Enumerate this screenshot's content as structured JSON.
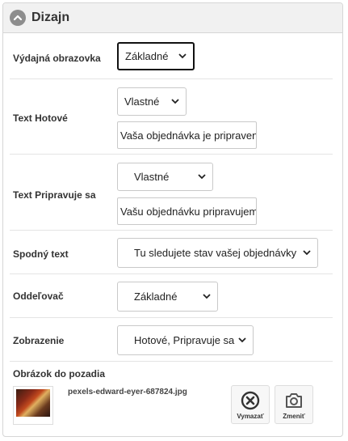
{
  "header": {
    "title": "Dizajn",
    "collapse_icon": "chevron-up-circle-icon"
  },
  "rows": {
    "vydajna": {
      "label": "Výdajná obrazovka",
      "select_value": "Základné"
    },
    "hotove": {
      "label": "Text Hotové",
      "select_value": "Vlastné",
      "input_value": "Vaša objednávka je pripravená"
    },
    "pripravuje": {
      "label": "Text Pripravuje sa",
      "select_value": "Vlastné",
      "input_value": "Vašu objednávku pripravujeme"
    },
    "spodny": {
      "label": "Spodný text",
      "select_value": "Tu sledujete stav vašej objednávky"
    },
    "oddelovac": {
      "label": "Oddeľovač",
      "select_value": "Základné"
    },
    "zobrazenie": {
      "label": "Zobrazenie",
      "select_value": "Hotové, Pripravuje sa"
    },
    "obrazok": {
      "label": "Obrázok do pozadia",
      "filename": "pexels-edward-eyer-687824.jpg",
      "delete_label": "Vymazať",
      "change_label": "Zmeniť"
    }
  },
  "colors": {
    "header_bg": "#f1f1f1",
    "border": "#d6d6d6",
    "icon_gray": "#8d8d8d"
  }
}
